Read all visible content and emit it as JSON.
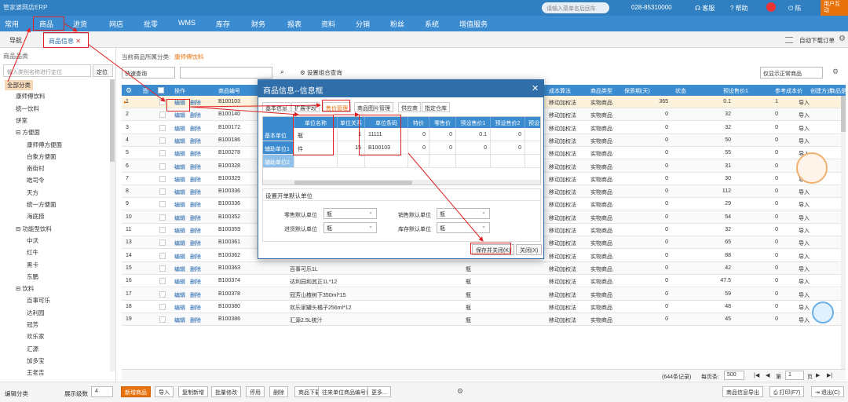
{
  "app": {
    "logo": "管家婆网店ERP",
    "search_placeholder": "请输入菜单名后回车",
    "phone": "028-85310000",
    "service": "客服",
    "help": "帮助",
    "user": "陈",
    "corner": "用户互动"
  },
  "nav": [
    "常用",
    "商品",
    "进货",
    "网店",
    "批零",
    "WMS",
    "库存",
    "财务",
    "报表",
    "资料",
    "分销",
    "粉丝",
    "系统",
    "增值服务"
  ],
  "tabs": {
    "nav": "导航",
    "active": "商品信息",
    "auto_order": "自动下载订单"
  },
  "side": {
    "title": "商品品类",
    "search_placeholder": "输入类别名称进行定位",
    "locate": "定位",
    "tree": [
      {
        "label": "全部分类",
        "level": 0,
        "selected": true
      },
      {
        "label": "康师傅饮料",
        "level": 1
      },
      {
        "label": "统一饮料",
        "level": 1
      },
      {
        "label": "饼室",
        "level": 1
      },
      {
        "label": "方便面",
        "level": 1,
        "group": true
      },
      {
        "label": "康师傅方便面",
        "level": 2
      },
      {
        "label": "白象方便面",
        "level": 2
      },
      {
        "label": "南街村",
        "level": 2
      },
      {
        "label": "皓司令",
        "level": 2
      },
      {
        "label": "天方",
        "level": 2
      },
      {
        "label": "统一方便面",
        "level": 2
      },
      {
        "label": "海底捞",
        "level": 2
      },
      {
        "label": "功能型饮料",
        "level": 1,
        "group": true
      },
      {
        "label": "中沃",
        "level": 2
      },
      {
        "label": "红牛",
        "level": 2
      },
      {
        "label": "黑卡",
        "level": 2
      },
      {
        "label": "东鹏",
        "level": 2
      },
      {
        "label": "饮料",
        "level": 1,
        "group": true
      },
      {
        "label": "百事可乐",
        "level": 2
      },
      {
        "label": "达利园",
        "level": 2
      },
      {
        "label": "冠芳",
        "level": 2
      },
      {
        "label": "欢乐家",
        "level": 2
      },
      {
        "label": "汇源",
        "level": 2
      },
      {
        "label": "加多宝",
        "level": 2
      },
      {
        "label": "王老吉",
        "level": 2
      }
    ],
    "display_cat": "编辑分类",
    "level_label": "展示级数",
    "level_value": "4"
  },
  "filter": {
    "current_label": "当前商品所属分类:",
    "current_value": "康师傅饮料",
    "query_type": "快速查询",
    "combo": "设置组合查询",
    "display": "仅显示正常商品"
  },
  "grid": {
    "headers": [
      "图",
      "",
      "操作",
      "商品编号",
      "",
      "单位",
      "",
      "成本算法",
      "商品类型",
      "保质期(天)",
      "状态",
      "预设售价1",
      "参考成本价",
      "创建方式",
      "商品是"
    ],
    "rows": [
      {
        "n": "1",
        "code": "B100103",
        "name": "",
        "unit": "",
        "algo": "移动加权法",
        "type": "实物商品",
        "shelf": "365",
        "status": "",
        "price": "0.1",
        "cost": "1",
        "mode": "导入"
      },
      {
        "n": "2",
        "code": "B100140",
        "name": "",
        "unit": "",
        "algo": "移动加权法",
        "type": "实物商品",
        "shelf": "0",
        "status": "",
        "price": "32",
        "cost": "0",
        "mode": "导入"
      },
      {
        "n": "3",
        "code": "B100172",
        "name": "",
        "unit": "",
        "algo": "移动加权法",
        "type": "实物商品",
        "shelf": "0",
        "status": "",
        "price": "32",
        "cost": "0",
        "mode": "导入"
      },
      {
        "n": "4",
        "code": "B100186",
        "name": "",
        "unit": "",
        "algo": "移动加权法",
        "type": "实物商品",
        "shelf": "0",
        "status": "",
        "price": "50",
        "cost": "0",
        "mode": "导入"
      },
      {
        "n": "5",
        "code": "B100278",
        "name": "",
        "unit": "",
        "algo": "移动加权法",
        "type": "实物商品",
        "shelf": "0",
        "status": "",
        "price": "55",
        "cost": "0",
        "mode": "导入"
      },
      {
        "n": "6",
        "code": "B100328",
        "name": "",
        "unit": "",
        "algo": "移动加权法",
        "type": "实物商品",
        "shelf": "0",
        "status": "",
        "price": "31",
        "cost": "0",
        "mode": "导入"
      },
      {
        "n": "7",
        "code": "B100329",
        "name": "",
        "unit": "",
        "algo": "移动加权法",
        "type": "实物商品",
        "shelf": "0",
        "status": "",
        "price": "30",
        "cost": "0",
        "mode": "导入"
      },
      {
        "n": "8",
        "code": "B100336",
        "name": "",
        "unit": "",
        "algo": "移动加权法",
        "type": "实物商品",
        "shelf": "0",
        "status": "",
        "price": "112",
        "cost": "0",
        "mode": "导入"
      },
      {
        "n": "9",
        "code": "B100336",
        "name": "",
        "unit": "",
        "algo": "移动加权法",
        "type": "实物商品",
        "shelf": "0",
        "status": "",
        "price": "29",
        "cost": "0",
        "mode": "导入"
      },
      {
        "n": "10",
        "code": "B100352",
        "name": "",
        "unit": "",
        "algo": "移动加权法",
        "type": "实物商品",
        "shelf": "0",
        "status": "",
        "price": "54",
        "cost": "0",
        "mode": "导入"
      },
      {
        "n": "11",
        "code": "B100359",
        "name": "",
        "unit": "",
        "algo": "移动加权法",
        "type": "实物商品",
        "shelf": "0",
        "status": "",
        "price": "32",
        "cost": "0",
        "mode": "导入"
      },
      {
        "n": "13",
        "code": "B100361",
        "name": "黑卡6小时450ml",
        "unit": "瓶",
        "algo": "移动加权法",
        "type": "实物商品",
        "shelf": "0",
        "status": "",
        "price": "65",
        "cost": "0",
        "mode": "导入"
      },
      {
        "n": "14",
        "code": "B100362",
        "name": "东鹏特饮",
        "unit": "瓶",
        "algo": "移动加权法",
        "type": "实物商品",
        "shelf": "0",
        "status": "",
        "price": "88",
        "cost": "0",
        "mode": "导入"
      },
      {
        "n": "15",
        "code": "B100363",
        "name": "百事可乐1L",
        "unit": "瓶",
        "algo": "移动加权法",
        "type": "实物商品",
        "shelf": "0",
        "status": "",
        "price": "42",
        "cost": "0",
        "mode": "导入"
      },
      {
        "n": "16",
        "code": "B100374",
        "name": "达利园和其正1L*12",
        "unit": "瓶",
        "algo": "移动加权法",
        "type": "实物商品",
        "shelf": "0",
        "status": "",
        "price": "47.5",
        "cost": "0",
        "mode": "导入"
      },
      {
        "n": "17",
        "code": "B100378",
        "name": "冠芳山楂树下350ml*15",
        "unit": "瓶",
        "algo": "移动加权法",
        "type": "实物商品",
        "shelf": "0",
        "status": "",
        "price": "59",
        "cost": "0",
        "mode": "导入"
      },
      {
        "n": "18",
        "code": "B100380",
        "name": "欢乐家罐头橘子256ml*12",
        "unit": "瓶",
        "algo": "移动加权法",
        "type": "实物商品",
        "shelf": "0",
        "status": "",
        "price": "48",
        "cost": "0",
        "mode": "导入"
      },
      {
        "n": "19",
        "code": "B100386",
        "name": "汇源2.5L统汁",
        "unit": "瓶",
        "algo": "移动加权法",
        "type": "实物商品",
        "shelf": "0",
        "status": "",
        "price": "45",
        "cost": "0",
        "mode": "导入"
      }
    ],
    "edit": "编辑",
    "del": "删除",
    "footer": {
      "count": "(644条记录)",
      "per_page_label": "每页条:",
      "per_page": "500",
      "page_label": "第",
      "page": "1",
      "pages": "页"
    }
  },
  "modal": {
    "title": "商品信息--信息框",
    "tabs": [
      "基本信息",
      "扩展字段",
      "售价管理",
      "商品图片管理",
      "供应商",
      "指定仓库"
    ],
    "headers": [
      "单位名称",
      "单位关系",
      "单位条码",
      "特价",
      "零售价",
      "预设售价1",
      "预设售价2",
      "预设售"
    ],
    "rows": [
      {
        "label": "基本单位",
        "name": "瓶",
        "rel": "1",
        "code": "11111",
        "special": "0",
        "retail": "0",
        "p1": "0.1",
        "p2": "0"
      },
      {
        "label": "辅助单位1",
        "name": "件",
        "rel": "15",
        "code": "B100103",
        "special": "0",
        "retail": "0",
        "p1": "0",
        "p2": "0"
      },
      {
        "label": "辅助单位2",
        "name": "",
        "rel": "",
        "code": "",
        "special": "",
        "retail": "",
        "p1": "",
        "p2": ""
      }
    ],
    "section": "设置开单默认单位",
    "retail_label": "零售默认单位",
    "retail_val": "瓶",
    "sale_label": "销售默认单位",
    "sale_val": "瓶",
    "buy_label": "进货默认单位",
    "buy_val": "瓶",
    "stock_label": "库存默认单位",
    "stock_val": "瓶",
    "save": "保存并关闭(K)",
    "close": "关闭(X)"
  },
  "toolbar": [
    "新增商品",
    "导入",
    "复制新增",
    "批量修改",
    "停用",
    "删除",
    "商品下载与对应",
    "往来单位商品编号设置",
    "更多..."
  ],
  "toolbar_right": {
    "export": "商品信息导出",
    "print": "打印(F7)",
    "exit": "退出(C)"
  },
  "colors": {
    "primary": "#2f7fc1",
    "accent": "#e8720c",
    "annotation": "#e02020"
  }
}
